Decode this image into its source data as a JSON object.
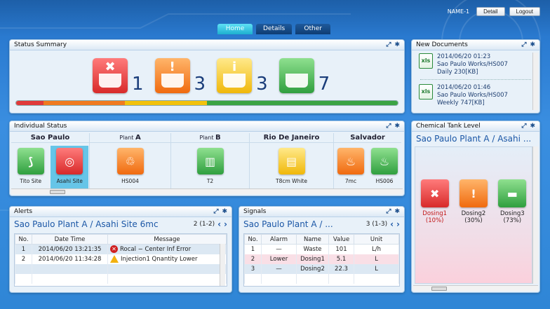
{
  "header": {
    "user_name": "NAME-1",
    "detail_label": "Detail",
    "logout_label": "Logout"
  },
  "tabs": [
    {
      "label": "Home",
      "active": true
    },
    {
      "label": "Details",
      "active": false
    },
    {
      "label": "Other",
      "active": false
    }
  ],
  "status_summary": {
    "title": "Status Summary",
    "items": [
      {
        "icon": "error-tank-icon",
        "count": "1"
      },
      {
        "icon": "warning-tank-icon",
        "count": "3"
      },
      {
        "icon": "info-tank-icon",
        "count": "3"
      },
      {
        "icon": "normal-tank-icon",
        "count": "7"
      }
    ],
    "bar_colors": [
      "#e03a3a",
      "#f07a20",
      "#f2c20c",
      "#3aa444"
    ]
  },
  "new_documents": {
    "title": "New Documents",
    "docs": [
      {
        "date": "2014/06/20 01:23",
        "path": "Sao Paulo Works/HS007",
        "desc": "Daily 230[KB]"
      },
      {
        "date": "2014/06/20 01:46",
        "path": "Sao Paulo Works/HS007",
        "desc": "Weekly 747[KB]"
      }
    ]
  },
  "individual_status": {
    "title": "Individual Status",
    "groups": [
      {
        "title": "Sao Paulo",
        "sites": [
          {
            "label": "Tito Site",
            "color": "green"
          },
          {
            "label": "Asahi Site",
            "color": "red"
          }
        ]
      },
      {
        "title_prefix": "Plant",
        "title": "A",
        "sites": [
          {
            "label": "HS004",
            "color": "orange"
          }
        ]
      },
      {
        "title_prefix": "Plant",
        "title": "B",
        "sites": [
          {
            "label": "T2",
            "color": "green"
          }
        ]
      },
      {
        "title": "Rio De Janeiro",
        "sites": [
          {
            "label": "T8cm White",
            "color": "yellow"
          }
        ]
      },
      {
        "title": "Salvador",
        "sites": [
          {
            "label": "7mc",
            "color": "orange"
          },
          {
            "label": "HS006",
            "color": "green"
          }
        ]
      }
    ]
  },
  "chemical_tank": {
    "title": "Chemical Tank Level",
    "location": "Sao Paulo Plant A / Asahi ...",
    "tanks": [
      {
        "name": "Dosing1",
        "pct": "(10%)",
        "color": "red"
      },
      {
        "name": "Dosing2",
        "pct": "(30%)",
        "color": "orange"
      },
      {
        "name": "Dosing3",
        "pct": "(73%)",
        "color": "green"
      }
    ]
  },
  "alerts": {
    "title": "Alerts",
    "location": "Sao Paulo Plant A / Asahi Site 6mc",
    "pager": "2 (1-2)",
    "columns": [
      "No.",
      "Date Time",
      "Message"
    ],
    "rows": [
      {
        "no": "1",
        "datetime": "2014/06/20 13:21:35",
        "type": "error",
        "message": "Rocal − Center Inf Error"
      },
      {
        "no": "2",
        "datetime": "2014/06/20 11:34:28",
        "type": "warning",
        "message": "Injection1 Qnantity Lower"
      }
    ]
  },
  "signals": {
    "title": "Signals",
    "location": "Sao Paulo Plant A / ...",
    "pager": "3 (1-3)",
    "columns": [
      "No.",
      "Alarm",
      "Name",
      "Value",
      "Unit"
    ],
    "rows": [
      {
        "no": "1",
        "alarm": "—",
        "name": "Waste",
        "value": "101",
        "unit": "L/h"
      },
      {
        "no": "2",
        "alarm": "Lower",
        "name": "Dosing1",
        "value": "5.1",
        "unit": "L"
      },
      {
        "no": "3",
        "alarm": "—",
        "name": "Dosing2",
        "value": "22.3",
        "unit": "L"
      }
    ]
  }
}
